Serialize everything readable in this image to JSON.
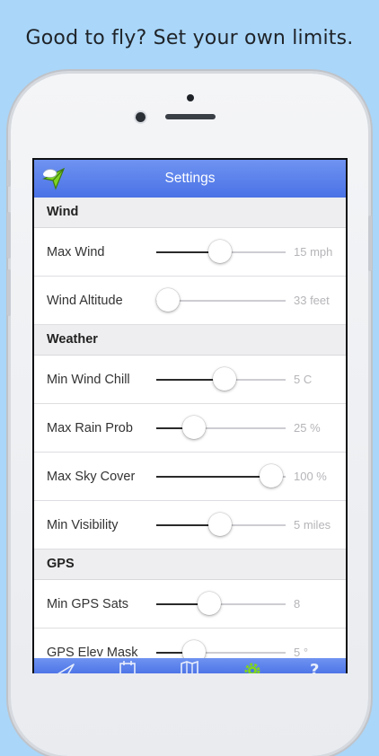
{
  "caption": "Good to fly? Set your own limits.",
  "navbar": {
    "title": "Settings"
  },
  "sections": [
    {
      "header": "Wind",
      "rows": [
        {
          "label": "Max Wind",
          "value": "15 mph",
          "level": 0.49
        },
        {
          "label": "Wind Altitude",
          "value": "33 feet",
          "level": 0.09
        }
      ]
    },
    {
      "header": "Weather",
      "rows": [
        {
          "label": "Min Wind Chill",
          "value": "5 C",
          "level": 0.53
        },
        {
          "label": "Max Rain Prob",
          "value": "25 %",
          "level": 0.29
        },
        {
          "label": "Max Sky Cover",
          "value": "100 %",
          "level": 0.89
        },
        {
          "label": "Min Visibility",
          "value": "5 miles",
          "level": 0.49
        }
      ]
    },
    {
      "header": "GPS",
      "rows": [
        {
          "label": "Min GPS Sats",
          "value": "8",
          "level": 0.41
        },
        {
          "label": "GPS Elev Mask",
          "value": "5 °",
          "level": 0.29
        }
      ]
    }
  ],
  "tabbar": {
    "tabs": [
      {
        "icon": "plane-icon",
        "active": false
      },
      {
        "icon": "calendar-icon",
        "active": false
      },
      {
        "icon": "map-icon",
        "active": false
      },
      {
        "icon": "gear-icon",
        "active": true
      },
      {
        "icon": "help-icon",
        "active": false
      }
    ]
  },
  "colors": {
    "nav": "#4a72e6",
    "background": "#a9d6f9",
    "active_tab": "#7ed321"
  }
}
